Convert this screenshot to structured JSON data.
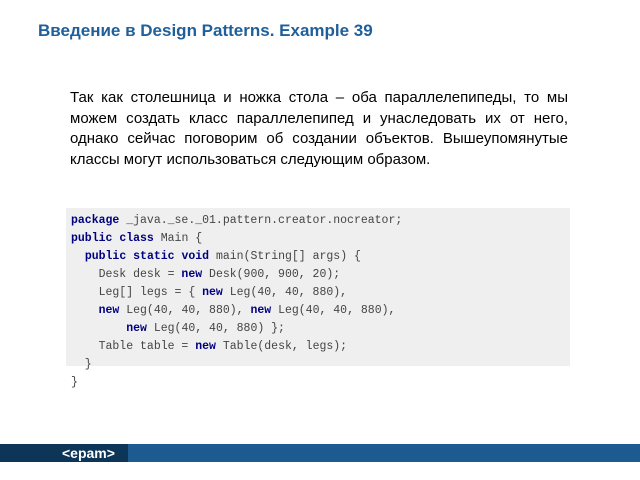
{
  "title": "Введение в Design Patterns. Example 39",
  "body_text": "Так как столешница и ножка стола – оба параллелепипеды, то мы можем создать класс параллелепипед и унаследовать их от него, однако сейчас поговорим об создании объектов. Вышеупомянутые классы могут использоваться следующим образом.",
  "code": {
    "lines": [
      [
        {
          "t": "package",
          "kw": true
        },
        {
          "t": " _java._se._01.pattern.creator.nocreator;"
        }
      ],
      [
        {
          "t": "public",
          "kw": true
        },
        {
          "t": " "
        },
        {
          "t": "class",
          "kw": true
        },
        {
          "t": " Main {"
        }
      ],
      [
        {
          "t": "  "
        },
        {
          "t": "public",
          "kw": true
        },
        {
          "t": " "
        },
        {
          "t": "static",
          "kw": true
        },
        {
          "t": " "
        },
        {
          "t": "void",
          "kw": true
        },
        {
          "t": " main(String[] args) {"
        }
      ],
      [
        {
          "t": "    Desk desk = "
        },
        {
          "t": "new",
          "kw": true
        },
        {
          "t": " Desk(900, 900, 20);"
        }
      ],
      [
        {
          "t": "    Leg[] legs = { "
        },
        {
          "t": "new",
          "kw": true
        },
        {
          "t": " Leg(40, 40, 880),"
        }
      ],
      [
        {
          "t": "    "
        },
        {
          "t": "new",
          "kw": true
        },
        {
          "t": " Leg(40, 40, 880), "
        },
        {
          "t": "new",
          "kw": true
        },
        {
          "t": " Leg(40, 40, 880),"
        }
      ],
      [
        {
          "t": "        "
        },
        {
          "t": "new",
          "kw": true
        },
        {
          "t": " Leg(40, 40, 880) };"
        }
      ],
      [
        {
          "t": "    Table table = "
        },
        {
          "t": "new",
          "kw": true
        },
        {
          "t": " Table(desk, legs);"
        }
      ],
      [
        {
          "t": "  }"
        }
      ],
      [
        {
          "t": "}"
        }
      ]
    ]
  },
  "footer": {
    "logo_text": "<epam>"
  },
  "colors": {
    "title": "#1f5f9a",
    "keyword": "#000080",
    "code_text": "#444444",
    "code_background": "#efefef",
    "footer_bar": "#1c5a8f",
    "footer_dark": "#0c3557"
  }
}
